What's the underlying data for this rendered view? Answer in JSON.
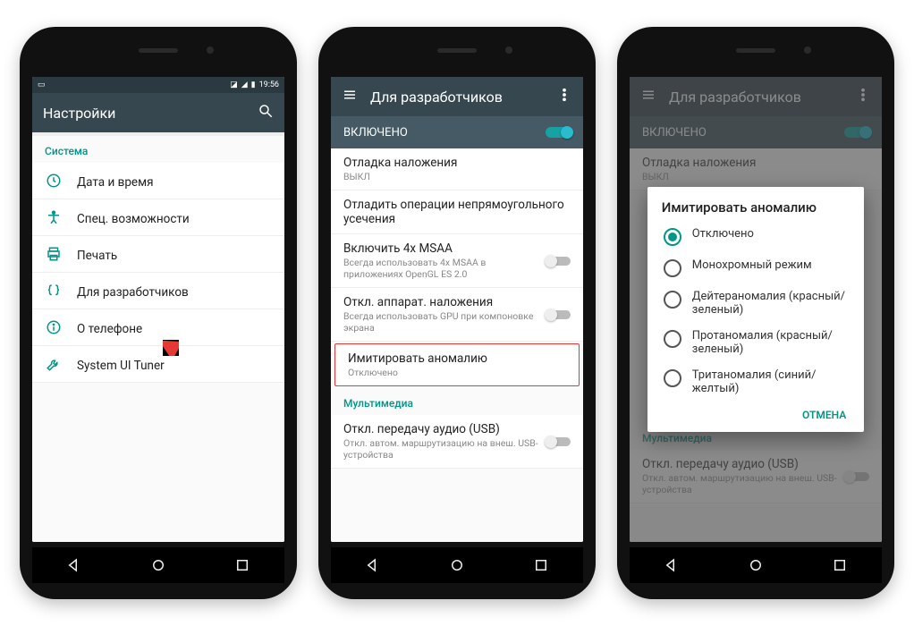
{
  "colors": {
    "teal": "#009688",
    "appbar": "#37474f",
    "enabled": "#455a64",
    "highlight": "#e53935"
  },
  "status": {
    "time": "19:56"
  },
  "phone1": {
    "title": "Настройки",
    "section": "Система",
    "items": [
      {
        "icon": "clock-icon",
        "label": "Дата и время"
      },
      {
        "icon": "accessibility-icon",
        "label": "Спец. возможности"
      },
      {
        "icon": "print-icon",
        "label": "Печать"
      },
      {
        "icon": "braces-icon",
        "label": "Для разработчиков"
      },
      {
        "icon": "info-icon",
        "label": "О телефоне"
      },
      {
        "icon": "wrench-icon",
        "label": "System UI Tuner"
      }
    ]
  },
  "phone2": {
    "title": "Для разработчиков",
    "enabled_label": "ВКЛЮЧЕНО",
    "rows": [
      {
        "primary": "Отладка наложения",
        "secondary": "ВЫКЛ"
      },
      {
        "primary": "Отладить операции непрямоугольного усечения"
      },
      {
        "primary": "Включить 4x MSAA",
        "secondary": "Всегда использовать 4x MSAA в приложениях OpenGL ES 2.0",
        "switch": true
      },
      {
        "primary": "Откл. аппарат. наложения",
        "secondary": "Всегда использовать GPU при компоновке экрана",
        "switch": true
      },
      {
        "primary": "Имитировать аномалию",
        "secondary": "Отключено",
        "highlight": true
      }
    ],
    "section2": "Мультимедиа",
    "rows2": [
      {
        "primary": "Откл. передачу аудио (USB)",
        "secondary": "Откл. автом. маршрутизацию на внеш. USB-устройства",
        "switch": true
      }
    ]
  },
  "phone3": {
    "title": "Для разработчиков",
    "enabled_label": "ВКЛЮЧЕНО",
    "bg_rows": [
      {
        "primary": "Отладка наложения",
        "secondary": "ВЫКЛ"
      }
    ],
    "section2": "Мультимедиа",
    "bg_rows2": [
      {
        "primary": "Откл. передачу аудио (USB)",
        "secondary": "Откл. автом. маршрутизацию на внеш. USB-устройства",
        "switch": true
      }
    ],
    "dialog": {
      "title": "Имитировать аномалию",
      "options": [
        {
          "label": "Отключено",
          "checked": true
        },
        {
          "label": "Монохромный режим"
        },
        {
          "label": "Дейтераномалия (красный/зеленый)"
        },
        {
          "label": "Протаномалия (красный/зеленый)"
        },
        {
          "label": "Тританомалия (синий/желтый)"
        }
      ],
      "cancel": "ОТМЕНА"
    }
  }
}
